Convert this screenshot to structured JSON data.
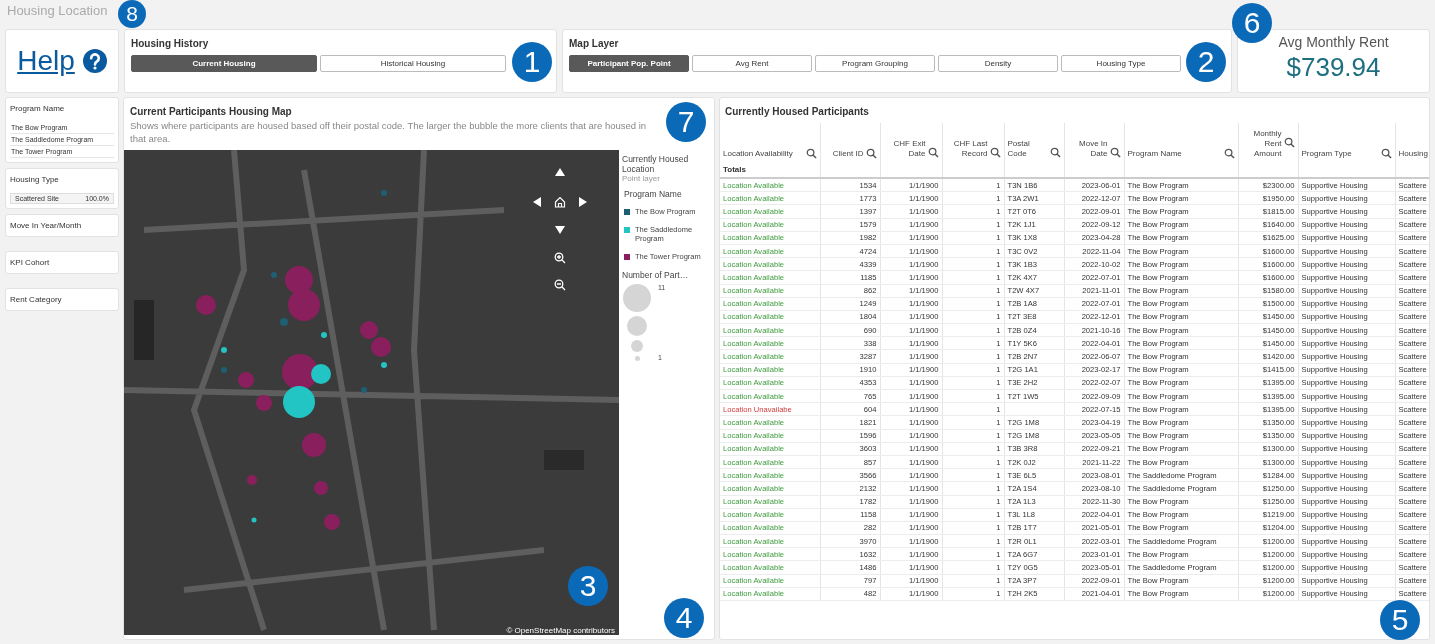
{
  "title": "Housing Location",
  "help": {
    "label": "Help"
  },
  "housing_history": {
    "title": "Housing History",
    "options": [
      {
        "label": "Current Housing",
        "selected": true
      },
      {
        "label": "Historical Housing",
        "selected": false
      }
    ]
  },
  "map_layer": {
    "title": "Map Layer",
    "options": [
      {
        "label": "Participant Pop. Point",
        "selected": true
      },
      {
        "label": "Avg Rent",
        "selected": false
      },
      {
        "label": "Program Grouping",
        "selected": false
      },
      {
        "label": "Density",
        "selected": false
      },
      {
        "label": "Housing Type",
        "selected": false
      }
    ]
  },
  "kpi": {
    "label": "Avg Monthly Rent",
    "value": "$739.94"
  },
  "filters": [
    {
      "kind": "list",
      "title": "Program Name",
      "items": [
        "The Bow Program",
        "The Saddledome Program",
        "The Tower Program"
      ]
    },
    {
      "kind": "values",
      "title": "Housing Type",
      "items": [
        {
          "label": "Scattered Site",
          "value": "100.0%"
        }
      ]
    },
    {
      "kind": "title",
      "title": "Move In Year/Month"
    },
    {
      "kind": "title",
      "title": "KPI Cohort"
    },
    {
      "kind": "title",
      "title": "Rent Category"
    }
  ],
  "map": {
    "title": "Current Participants Housing Map",
    "description": "Shows where participants are housed based off their postal code. The larger the bubble the more clients that are housed in that area.",
    "attribution": "© OpenStreetMap contributors",
    "legend": {
      "layer": "Currently Housed Location",
      "sublabel": "Point layer",
      "color_title": "Program Name",
      "items": [
        {
          "label": "The Bow Program",
          "color": "#1d5f73"
        },
        {
          "label": "The Saddledome Program",
          "color": "#22c4c4"
        },
        {
          "label": "The Tower Program",
          "color": "#8a1f5e"
        }
      ],
      "size_title": "Number of Part…",
      "size_max": "11",
      "size_min": "1"
    }
  },
  "table": {
    "title": "Currently Housed Participants",
    "totals_label": "Totals",
    "columns": [
      {
        "label": "Location Availability",
        "search": true,
        "numeric": false
      },
      {
        "label": "Client ID",
        "search": true,
        "numeric": true
      },
      {
        "label": "CHF Exit Date",
        "search": true,
        "numeric": true
      },
      {
        "label": "CHF Last Record",
        "search": true,
        "numeric": true
      },
      {
        "label": "Postal Code",
        "search": true,
        "numeric": false
      },
      {
        "label": "Move In Date",
        "search": true,
        "numeric": true
      },
      {
        "label": "Program Name",
        "search": true,
        "numeric": false
      },
      {
        "label": "Monthly Rent Amount",
        "search": true,
        "numeric": true
      },
      {
        "label": "Program Type",
        "search": true,
        "numeric": false
      },
      {
        "label": "Housing",
        "numeric": false
      }
    ],
    "rows": [
      {
        "available": true,
        "cells": [
          "Location Available",
          "1534",
          "1/1/1900",
          "1",
          "T3N 1B6",
          "2023-06-01",
          "The Bow Program",
          "$2300.00",
          "Supportive Housing",
          "Scattere"
        ]
      },
      {
        "available": true,
        "cells": [
          "Location Available",
          "1773",
          "1/1/1900",
          "1",
          "T3A 2W1",
          "2022-12-07",
          "The Bow Program",
          "$1950.00",
          "Supportive Housing",
          "Scattere"
        ]
      },
      {
        "available": true,
        "cells": [
          "Location Available",
          "1397",
          "1/1/1900",
          "1",
          "T2T 0T6",
          "2022-09-01",
          "The Bow Program",
          "$1815.00",
          "Supportive Housing",
          "Scattere"
        ]
      },
      {
        "available": true,
        "cells": [
          "Location Available",
          "1579",
          "1/1/1900",
          "1",
          "T2K 1J1",
          "2022-09-12",
          "The Bow Program",
          "$1640.00",
          "Supportive Housing",
          "Scattere"
        ]
      },
      {
        "available": true,
        "cells": [
          "Location Available",
          "1982",
          "1/1/1900",
          "1",
          "T3K 1X8",
          "2023-04-28",
          "The Bow Program",
          "$1625.00",
          "Supportive Housing",
          "Scattere"
        ]
      },
      {
        "available": true,
        "cells": [
          "Location Available",
          "4724",
          "1/1/1900",
          "1",
          "T3C 0V2",
          "2022-11-04",
          "The Bow Program",
          "$1600.00",
          "Supportive Housing",
          "Scattere"
        ]
      },
      {
        "available": true,
        "cells": [
          "Location Available",
          "4339",
          "1/1/1900",
          "1",
          "T3K 1B3",
          "2022-10-02",
          "The Bow Program",
          "$1600.00",
          "Supportive Housing",
          "Scattere"
        ]
      },
      {
        "available": true,
        "cells": [
          "Location Available",
          "1185",
          "1/1/1900",
          "1",
          "T2K 4X7",
          "2022-07-01",
          "The Bow Program",
          "$1600.00",
          "Supportive Housing",
          "Scattere"
        ]
      },
      {
        "available": true,
        "cells": [
          "Location Available",
          "862",
          "1/1/1900",
          "1",
          "T2W 4X7",
          "2021-11-01",
          "The Bow Program",
          "$1580.00",
          "Supportive Housing",
          "Scattere"
        ]
      },
      {
        "available": true,
        "cells": [
          "Location Available",
          "1249",
          "1/1/1900",
          "1",
          "T2B 1A8",
          "2022-07-01",
          "The Bow Program",
          "$1500.00",
          "Supportive Housing",
          "Scattere"
        ]
      },
      {
        "available": true,
        "cells": [
          "Location Available",
          "1804",
          "1/1/1900",
          "1",
          "T2T 3E8",
          "2022-12-01",
          "The Bow Program",
          "$1450.00",
          "Supportive Housing",
          "Scattere"
        ]
      },
      {
        "available": true,
        "cells": [
          "Location Available",
          "690",
          "1/1/1900",
          "1",
          "T2B 0Z4",
          "2021-10-16",
          "The Bow Program",
          "$1450.00",
          "Supportive Housing",
          "Scattere"
        ]
      },
      {
        "available": true,
        "cells": [
          "Location Available",
          "338",
          "1/1/1900",
          "1",
          "T1Y 5K6",
          "2022-04-01",
          "The Bow Program",
          "$1450.00",
          "Supportive Housing",
          "Scattere"
        ]
      },
      {
        "available": true,
        "cells": [
          "Location Available",
          "3287",
          "1/1/1900",
          "1",
          "T2B 2N7",
          "2022-06-07",
          "The Bow Program",
          "$1420.00",
          "Supportive Housing",
          "Scattere"
        ]
      },
      {
        "available": true,
        "cells": [
          "Location Available",
          "1910",
          "1/1/1900",
          "1",
          "T2G 1A1",
          "2023-02-17",
          "The Bow Program",
          "$1415.00",
          "Supportive Housing",
          "Scattere"
        ]
      },
      {
        "available": true,
        "cells": [
          "Location Available",
          "4353",
          "1/1/1900",
          "1",
          "T3E 2H2",
          "2022-02-07",
          "The Bow Program",
          "$1395.00",
          "Supportive Housing",
          "Scattere"
        ]
      },
      {
        "available": true,
        "cells": [
          "Location Available",
          "765",
          "1/1/1900",
          "1",
          "T2T 1W5",
          "2022-09-09",
          "The Bow Program",
          "$1395.00",
          "Supportive Housing",
          "Scattere"
        ]
      },
      {
        "available": false,
        "cells": [
          "Location Unavailabe",
          "604",
          "1/1/1900",
          "1",
          "",
          "2022-07-15",
          "The Bow Program",
          "$1395.00",
          "Supportive Housing",
          "Scattere"
        ]
      },
      {
        "available": true,
        "cells": [
          "Location Available",
          "1821",
          "1/1/1900",
          "1",
          "T2G 1M8",
          "2023-04-19",
          "The Bow Program",
          "$1350.00",
          "Supportive Housing",
          "Scattere"
        ]
      },
      {
        "available": true,
        "cells": [
          "Location Available",
          "1596",
          "1/1/1900",
          "1",
          "T2G 1M8",
          "2023-05-05",
          "The Bow Program",
          "$1350.00",
          "Supportive Housing",
          "Scattere"
        ]
      },
      {
        "available": true,
        "cells": [
          "Location Available",
          "3603",
          "1/1/1900",
          "1",
          "T3B 3R8",
          "2022-09-21",
          "The Bow Program",
          "$1300.00",
          "Supportive Housing",
          "Scattere"
        ]
      },
      {
        "available": true,
        "cells": [
          "Location Available",
          "857",
          "1/1/1900",
          "1",
          "T2K 0J2",
          "2021-11-22",
          "The Bow Program",
          "$1300.00",
          "Supportive Housing",
          "Scattere"
        ]
      },
      {
        "available": true,
        "cells": [
          "Location Available",
          "3566",
          "1/1/1900",
          "1",
          "T3E 6L5",
          "2023-08-01",
          "The Saddledome Program",
          "$1284.00",
          "Supportive Housing",
          "Scattere"
        ]
      },
      {
        "available": true,
        "cells": [
          "Location Available",
          "2132",
          "1/1/1900",
          "1",
          "T2A 1S4",
          "2023-08-10",
          "The Saddledome Program",
          "$1250.00",
          "Supportive Housing",
          "Scattere"
        ]
      },
      {
        "available": true,
        "cells": [
          "Location Available",
          "1782",
          "1/1/1900",
          "1",
          "T2A 1L3",
          "2022-11-30",
          "The Bow Program",
          "$1250.00",
          "Supportive Housing",
          "Scattere"
        ]
      },
      {
        "available": true,
        "cells": [
          "Location Available",
          "1158",
          "1/1/1900",
          "1",
          "T3L 1L8",
          "2022-04-01",
          "The Bow Program",
          "$1219.00",
          "Supportive Housing",
          "Scattere"
        ]
      },
      {
        "available": true,
        "cells": [
          "Location Available",
          "282",
          "1/1/1900",
          "1",
          "T2B 1T7",
          "2021-05-01",
          "The Bow Program",
          "$1204.00",
          "Supportive Housing",
          "Scattere"
        ]
      },
      {
        "available": true,
        "cells": [
          "Location Available",
          "3970",
          "1/1/1900",
          "1",
          "T2R 0L1",
          "2022-03-01",
          "The Saddledome Program",
          "$1200.00",
          "Supportive Housing",
          "Scattere"
        ]
      },
      {
        "available": true,
        "cells": [
          "Location Available",
          "1632",
          "1/1/1900",
          "1",
          "T2A 6G7",
          "2023-01-01",
          "The Bow Program",
          "$1200.00",
          "Supportive Housing",
          "Scattere"
        ]
      },
      {
        "available": true,
        "cells": [
          "Location Available",
          "1486",
          "1/1/1900",
          "1",
          "T2Y 0G5",
          "2023-05-01",
          "The Saddledome Program",
          "$1200.00",
          "Supportive Housing",
          "Scattere"
        ]
      },
      {
        "available": true,
        "cells": [
          "Location Available",
          "797",
          "1/1/1900",
          "1",
          "T2A 3P7",
          "2022-09-01",
          "The Bow Program",
          "$1200.00",
          "Supportive Housing",
          "Scattere"
        ]
      },
      {
        "available": true,
        "cells": [
          "Location Available",
          "482",
          "1/1/1900",
          "1",
          "T2H 2K5",
          "2021-04-01",
          "The Bow Program",
          "$1200.00",
          "Supportive Housing",
          "Scattere"
        ]
      }
    ]
  },
  "callouts": [
    {
      "label": "1"
    },
    {
      "label": "2"
    },
    {
      "label": "3"
    },
    {
      "label": "4"
    },
    {
      "label": "5"
    },
    {
      "label": "6"
    },
    {
      "label": "7"
    },
    {
      "label": "8"
    }
  ]
}
